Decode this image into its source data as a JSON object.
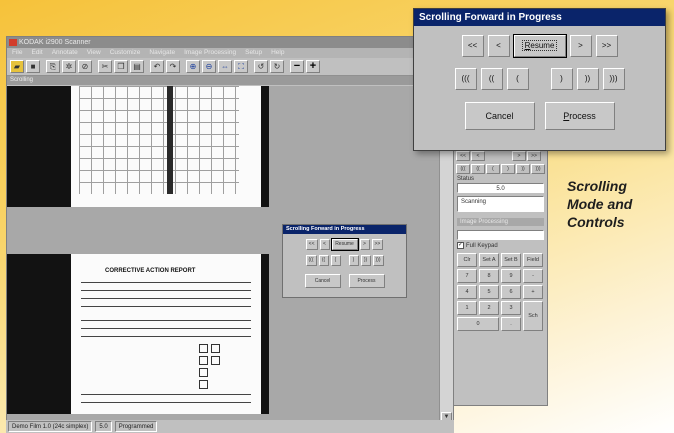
{
  "app": {
    "title": "KODAK i2900 Scanner",
    "menu": [
      "File",
      "Edit",
      "Annotate",
      "View",
      "Customize",
      "Navigate",
      "Image Processing",
      "Setup",
      "Help"
    ],
    "mode_label": "Scrolling"
  },
  "toolbar": {
    "icons": [
      "open-icon",
      "save-icon",
      "scan-icon",
      "rescan-icon",
      "stop-icon",
      "cut-icon",
      "copy-icon",
      "paste-icon",
      "undo-icon",
      "redo-icon",
      "zoom-in-icon",
      "zoom-out-icon",
      "fit-width-icon",
      "fit-page-icon",
      "rotate-left-icon",
      "rotate-right-icon"
    ],
    "zoom_minus": "−",
    "zoom_plus": "+"
  },
  "document": {
    "form_title": "CORRECTIVE ACTION REPORT"
  },
  "statusbar": {
    "items": [
      "Demo Film 1.0 (24c simplex)",
      "5.0",
      "Programmed"
    ]
  },
  "side_panel": {
    "nav_top": [
      "<<",
      "<",
      ">",
      ">>"
    ],
    "nav_mid": [
      "(((",
      "((",
      "(",
      ")",
      "))",
      ")))"
    ],
    "status_label": "Status",
    "status_value": "5.0",
    "state_value": "Scanning",
    "group_label": "Image Processing",
    "checkbox_label": "Full Keypad",
    "keypad": [
      "Clr",
      "Set A",
      "Set B",
      "Field",
      "7",
      "8",
      "9",
      "-",
      "4",
      "5",
      "6",
      "+",
      "1",
      "2",
      "3",
      "Sch",
      "0",
      "."
    ]
  },
  "mini_dialog": {
    "title": "Scrolling Forward in Progress",
    "row1": [
      "<<",
      "<",
      "Resume",
      ">",
      ">>"
    ],
    "row2": [
      "(((",
      "((",
      "(",
      ")",
      "))",
      ")))"
    ],
    "cancel": "Cancel",
    "process": "Process"
  },
  "dialog": {
    "title": "Scrolling Forward in Progress",
    "row1": [
      "<<",
      "<",
      ">",
      ">>"
    ],
    "resume_prefix": "",
    "resume_underline": "R",
    "resume_rest": "esume",
    "row2": [
      "(((",
      "((",
      "(",
      ")",
      "))",
      ")))"
    ],
    "cancel": "Cancel",
    "process_underline": "P",
    "process_rest": "rocess"
  },
  "caption": {
    "line1": "Scrolling",
    "line2": "Mode and",
    "line3": "Controls"
  }
}
